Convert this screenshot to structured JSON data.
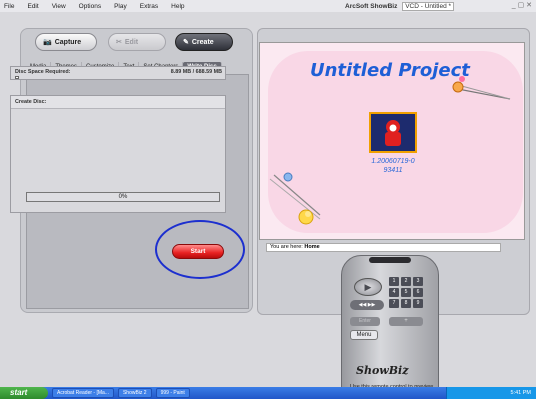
{
  "menu": [
    "File",
    "Edit",
    "View",
    "Options",
    "Play",
    "Extras",
    "Help"
  ],
  "window": {
    "app_name": "ArcSoft ShowBiz",
    "doc_title": "VCD - Untitled *",
    "controls": "_ ▢ ✕"
  },
  "modes": {
    "capture": "Capture",
    "edit": "Edit",
    "create": "Create"
  },
  "tabs": [
    {
      "label": "Media"
    },
    {
      "label": "Themes"
    },
    {
      "label": "Customize"
    },
    {
      "label": "Text"
    },
    {
      "label": "Set Chapters"
    },
    {
      "label": "Write Disc",
      "active": true
    }
  ],
  "disc_space": {
    "label": "Disc Space Required:",
    "value": "8.89 MB / 688.59 MB"
  },
  "create_disc": {
    "label": "Create Disc:"
  },
  "progress": {
    "percent": 0,
    "text": "0%"
  },
  "start_button": "Start",
  "preview": {
    "project_title": "Untitled Project",
    "thumb_caption_1": "1.20060719-0",
    "thumb_caption_2": "93411"
  },
  "location": {
    "prefix": "You are here:",
    "value": "Home"
  },
  "remote": {
    "play_symbol": "▶",
    "skip_symbols": "◀◀ ▶▶",
    "numbers": [
      "1",
      "2",
      "3",
      "4",
      "5",
      "6",
      "7",
      "8",
      "9"
    ],
    "enter": "Enter",
    "plus": "+",
    "menu": "Menu",
    "brand": "ShowBiz",
    "hint": "Use this remote control to preview your VCD project"
  },
  "taskbar": {
    "start": "start",
    "tasks": [
      "Acrobat Reader - [Ma...",
      "ShowBiz 2",
      "999 - Paint"
    ],
    "clock": "5:41 PM"
  },
  "colors": {
    "accent": "#1e5fd6",
    "start_red": "#e82222",
    "highlight_circle": "#1c2fcf"
  }
}
